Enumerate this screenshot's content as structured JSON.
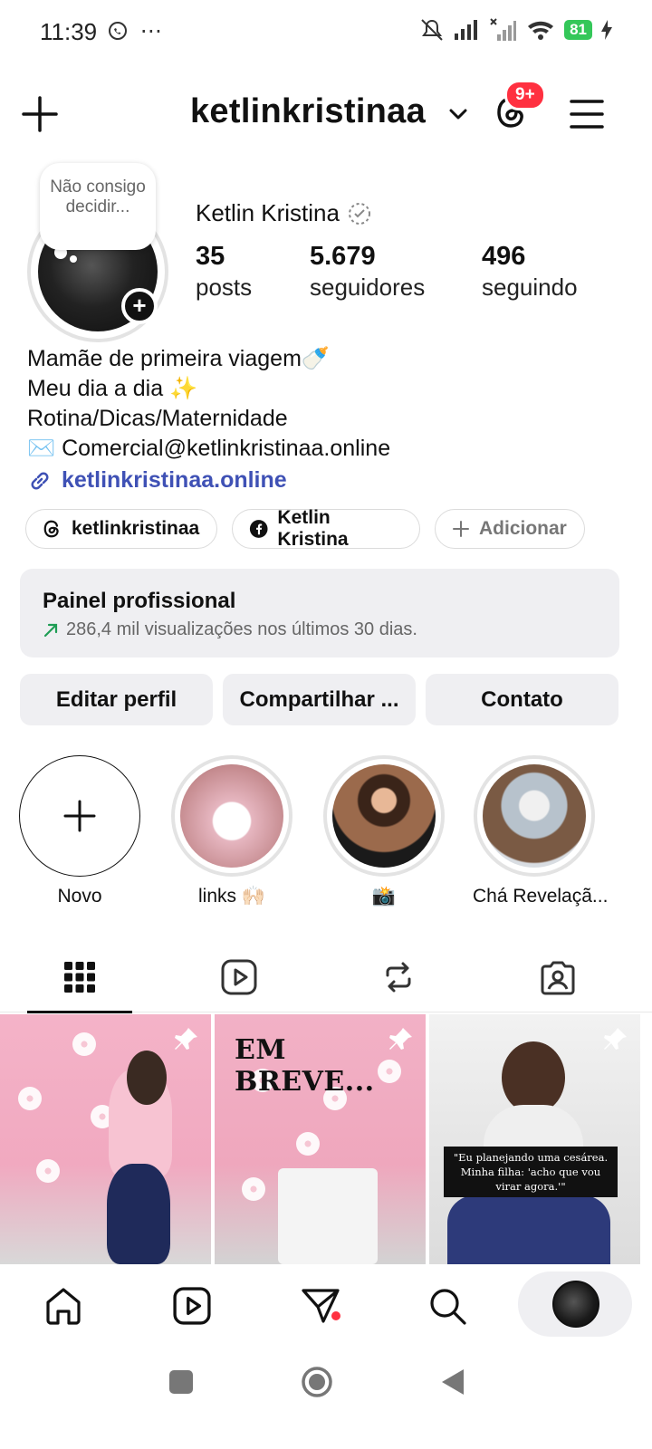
{
  "status_bar": {
    "time": "11:39",
    "extra": "⋯",
    "battery": "81"
  },
  "header": {
    "username": "ketlinkristinaa",
    "notification_badge": "9+"
  },
  "profile": {
    "note": "Não consigo decidir...",
    "display_name": "Ketlin Kristina",
    "stats": [
      {
        "value": "35",
        "label": "posts"
      },
      {
        "value": "5.679",
        "label": "seguidores"
      },
      {
        "value": "496",
        "label": "seguindo"
      }
    ],
    "bio": [
      "Mamãe de primeira viagem🍼",
      "Meu dia a dia ✨",
      "Rotina/Dicas/Maternidade",
      "✉️ Comercial@ketlinkristinaa.online"
    ],
    "link": "ketlinkristinaa.online",
    "pills": {
      "threads": "ketlinkristinaa",
      "facebook": "Ketlin Kristina",
      "add": "Adicionar"
    }
  },
  "pro_panel": {
    "title": "Painel profissional",
    "subtitle": "286,4 mil visualizações nos últimos 30 dias."
  },
  "actions": {
    "edit": "Editar perfil",
    "share": "Compartilhar ...",
    "contact": "Contato"
  },
  "highlights": [
    {
      "label": "Novo"
    },
    {
      "label": "links 🙌🏻"
    },
    {
      "label": "📸"
    },
    {
      "label": "Chá Revelaçã..."
    }
  ],
  "posts": {
    "em_breve": "EM BREVE...",
    "caption": "\"Eu planejando uma cesárea. Minha filha: 'acho que vou virar agora.'\""
  },
  "colors": {
    "accent_link": "#3f51b5",
    "badge": "#ff3040",
    "battery": "#34c759",
    "notification_dot": "#ff3040"
  }
}
